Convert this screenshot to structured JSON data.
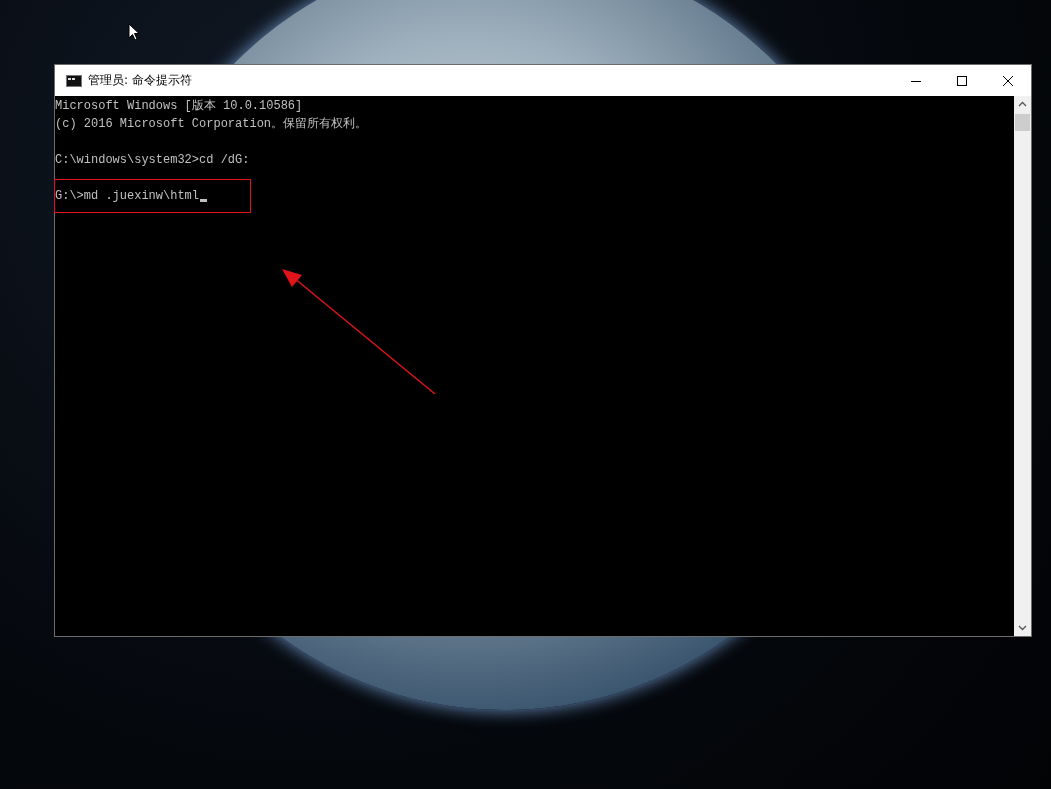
{
  "window": {
    "title": "管理员: 命令提示符"
  },
  "console": {
    "blocks": [
      {
        "lines": [
          "Microsoft Windows [版本 10.0.10586]",
          "(c) 2016 Microsoft Corporation。保留所有权利。"
        ],
        "highlighted": false
      },
      {
        "lines": [
          "C:\\windows\\system32>cd /dG:"
        ],
        "highlighted": false
      },
      {
        "lines": [
          "G:\\>md .juexinw\\html"
        ],
        "highlighted": true
      }
    ],
    "cursor": true
  }
}
